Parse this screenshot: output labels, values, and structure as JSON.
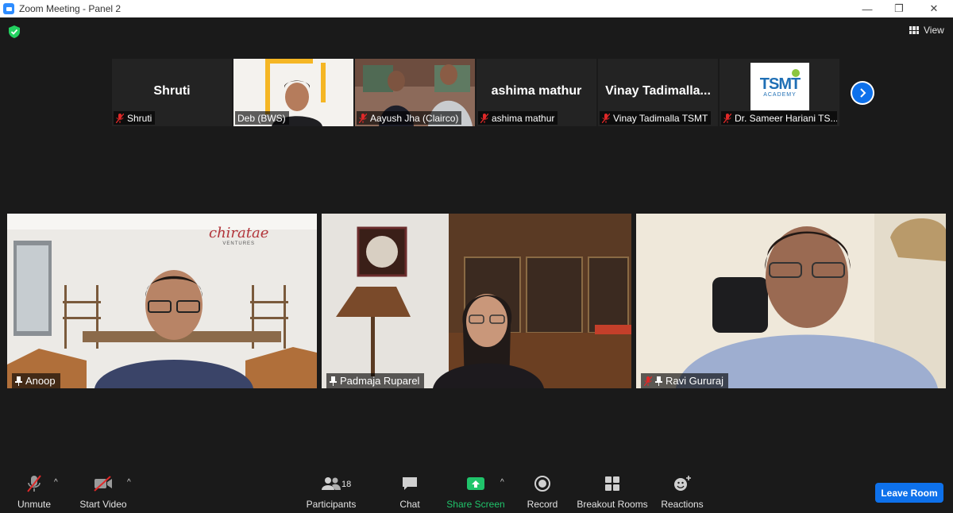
{
  "window": {
    "title": "Zoom Meeting - Panel 2",
    "minimize_glyph": "—",
    "maximize_glyph": "❐",
    "close_glyph": "✕"
  },
  "header": {
    "view_label": "View",
    "encryption_icon": "shield-check-icon",
    "shield_color": "#23d160"
  },
  "strip": {
    "tiles": [
      {
        "big_name": "Shruti",
        "tag": "Shruti",
        "muted": true,
        "video": false
      },
      {
        "big_name": "",
        "tag": "Deb (BWS)",
        "muted": false,
        "video": true
      },
      {
        "big_name": "",
        "tag": "Aayush Jha (Clairco)",
        "muted": true,
        "video": true
      },
      {
        "big_name": "ashima mathur",
        "tag": "ashima mathur",
        "muted": true,
        "video": false
      },
      {
        "big_name": "Vinay  Tadimalla...",
        "tag": "Vinay Tadimalla TSMT",
        "muted": true,
        "video": false
      },
      {
        "big_name": "",
        "tag": "Dr. Sameer Hariani TS...",
        "muted": true,
        "video": true,
        "logo_text": "TSMT",
        "logo_sub": "ACADEMY"
      }
    ],
    "next_icon": "chevron-right-icon"
  },
  "main_videos": [
    {
      "name": "Anoop",
      "pinned": true,
      "muted": false,
      "brand_text": "chiratae",
      "brand_sub": "VENTURES"
    },
    {
      "name": "Padmaja Ruparel",
      "pinned": true,
      "muted": false
    },
    {
      "name": "Ravi Gururaj",
      "pinned": true,
      "muted": true
    }
  ],
  "toolbar": {
    "unmute": "Unmute",
    "start_video": "Start Video",
    "participants": "Participants",
    "participants_count": "18",
    "chat": "Chat",
    "share_screen": "Share Screen",
    "record": "Record",
    "breakout_rooms": "Breakout Rooms",
    "reactions": "Reactions",
    "leave": "Leave Room",
    "caret": "^"
  },
  "colors": {
    "accent": "#0e71eb",
    "share_green": "#20c46b",
    "muted_red": "#e02828",
    "background": "#1a1a1a"
  }
}
